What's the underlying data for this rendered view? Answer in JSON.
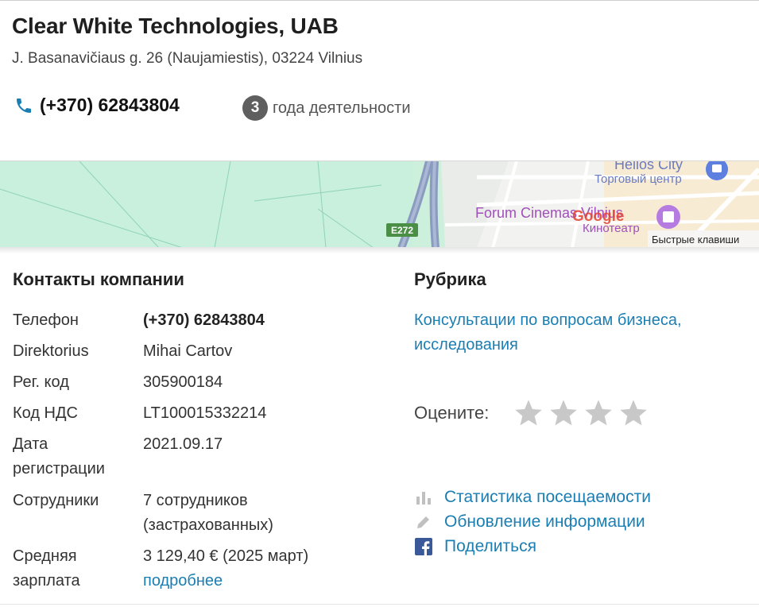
{
  "company": {
    "name": "Clear White Technologies, UAB",
    "address": "J. Basanavičiaus g. 26 (Naujamiestis), 03224 Vilnius",
    "phone": "(+370) 62843804",
    "years_count": "3",
    "years_text": "года деятельности"
  },
  "map": {
    "road_label": "E272",
    "poi_helios": "Helios City",
    "poi_helios_type": "Торговый центр",
    "poi_forum": "Forum Cinemas Vilnius",
    "poi_forum_type": "Кинотеатр",
    "google_logo": "Google",
    "shortcuts": "Быстрые клавиши"
  },
  "contacts": {
    "title": "Контакты компании",
    "rows": [
      {
        "label": "Телефон",
        "value": "(+370) 62843804"
      },
      {
        "label": "Direktorius",
        "value": "Mihai Cartov"
      },
      {
        "label": "Рег. код",
        "value": "305900184"
      },
      {
        "label": "Код НДС",
        "value": "LT100015332214"
      },
      {
        "label": "Дата регистрации",
        "value": "2021.09.17"
      },
      {
        "label": "Сотрудники",
        "value": "7 сотрудников (застрахованных)"
      },
      {
        "label": "Средняя зарплата",
        "value": "3 129,40 € (2025 март)",
        "link": "подробнее"
      }
    ]
  },
  "rubric": {
    "title": "Рубрика",
    "link": "Консультации по вопросам бизнеса, исследования"
  },
  "rating": {
    "label": "Оцените:",
    "max_stars": 4,
    "star_color": "#c8c8c8"
  },
  "actions": [
    {
      "label": "Статистика посещаемости",
      "icon": "bar-chart-icon"
    },
    {
      "label": "Обновление информации",
      "icon": "pencil-icon"
    },
    {
      "label": "Поделиться",
      "icon": "facebook-icon"
    }
  ],
  "colors": {
    "link": "#1b7eb3",
    "phone_icon": "#1b7eb3",
    "badge": "#5f5f5f",
    "map_green": "#c9f0dc",
    "facebook": "#3b5998"
  }
}
